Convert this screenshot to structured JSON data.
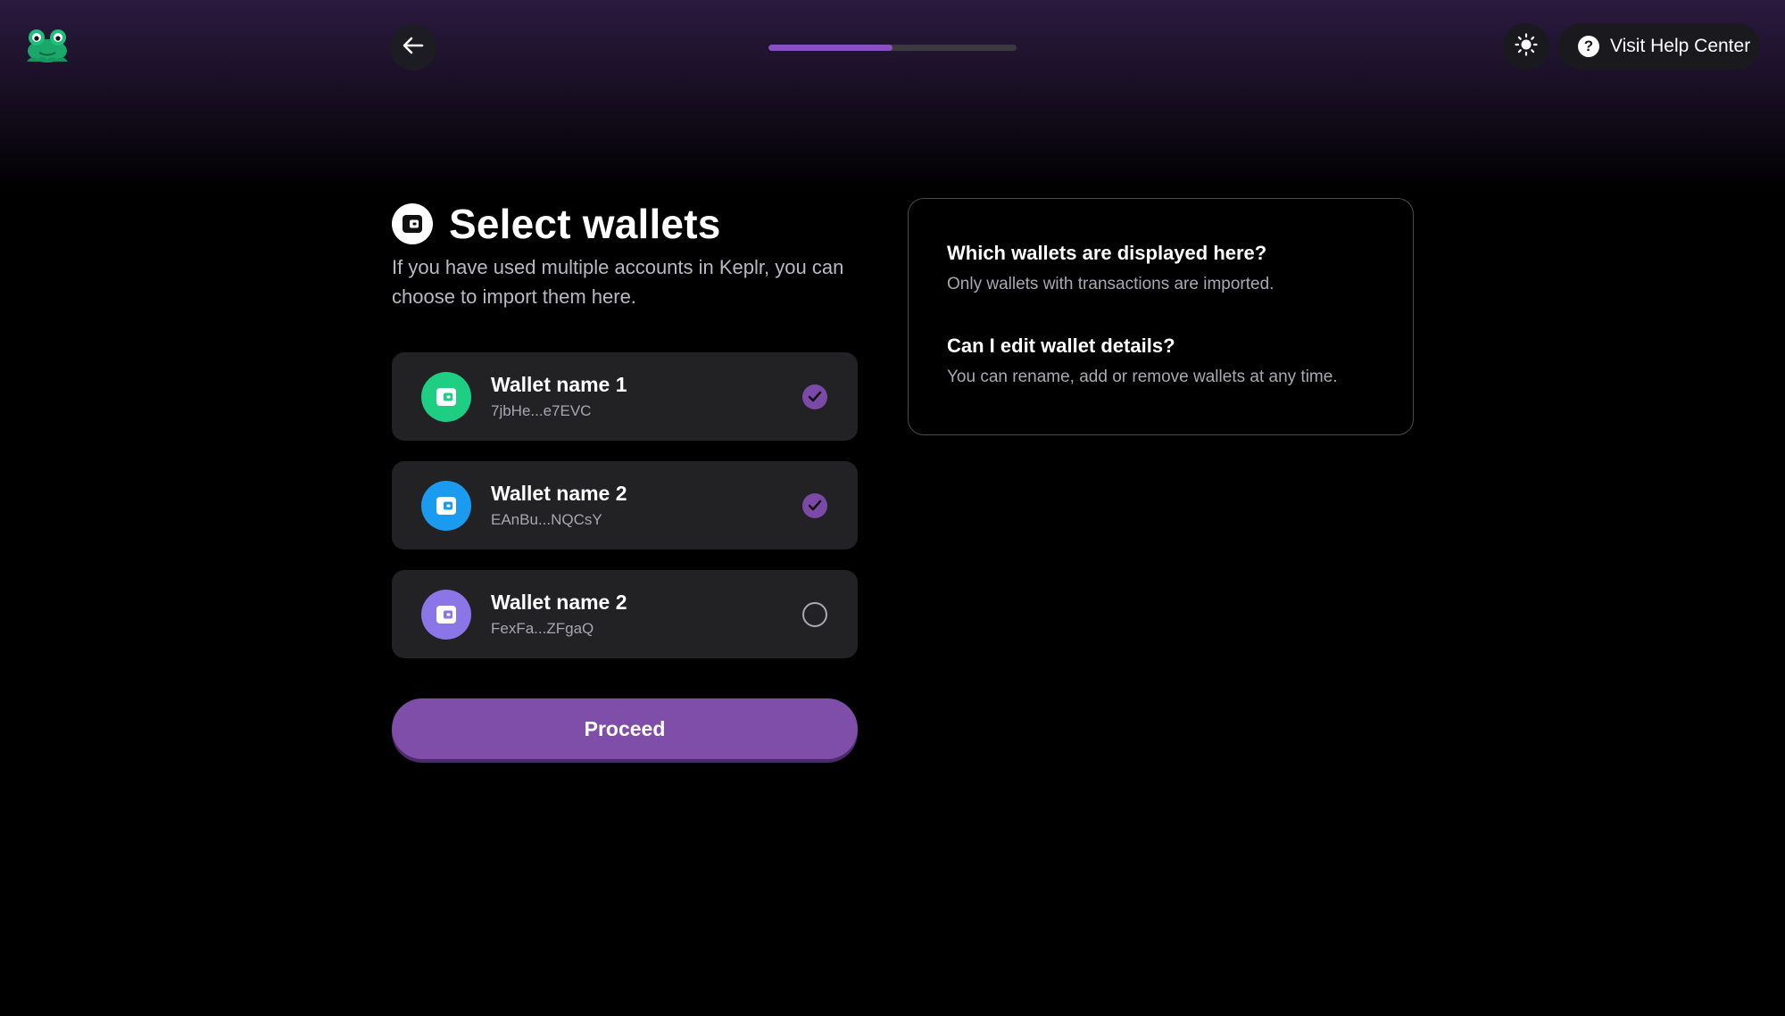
{
  "header": {
    "progress_fraction": 0.5,
    "help_label": "Visit Help Center",
    "accent": "#8a4fc0"
  },
  "main": {
    "title": "Select wallets",
    "subtitle": "If you have used multiple accounts in Keplr, you can choose to import them here.",
    "wallets": [
      {
        "name": "Wallet name 1",
        "address": "7jbHe...e7EVC",
        "color": "#1ecf83",
        "selected": true
      },
      {
        "name": "Wallet name 2",
        "address": "EAnBu...NQCsY",
        "color": "#1a9bf0",
        "selected": true
      },
      {
        "name": "Wallet name 2",
        "address": "FexFa...ZFgaQ",
        "color": "#8a76e6",
        "selected": false
      }
    ],
    "proceed_label": "Proceed"
  },
  "faq": {
    "items": [
      {
        "question": "Which wallets are displayed here?",
        "answer": "Only wallets with transactions are imported."
      },
      {
        "question": "Can I edit wallet details?",
        "answer": "You can rename, add or remove wallets at any time."
      }
    ]
  },
  "icons": {
    "logo": "frog-logo-icon",
    "back": "arrow-left-icon",
    "theme": "sun-icon",
    "help": "question-circle-icon",
    "wallet": "wallet-icon",
    "check": "checkmark-icon"
  }
}
